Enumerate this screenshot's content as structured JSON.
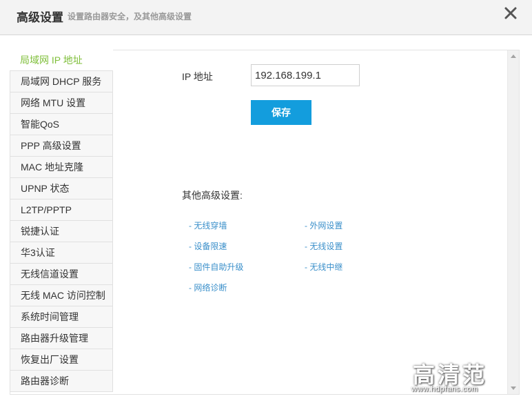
{
  "header": {
    "title": "高级设置",
    "subtitle": "设置路由器安全，及其他高级设置",
    "close_icon": "close-icon"
  },
  "sidebar": {
    "active_color": "#7fbf3a",
    "items": [
      {
        "label": "局域网 IP 地址",
        "active": true
      },
      {
        "label": "局域网 DHCP 服务"
      },
      {
        "label": "网络 MTU 设置"
      },
      {
        "label": "智能QoS"
      },
      {
        "label": "PPP 高级设置"
      },
      {
        "label": "MAC 地址克隆"
      },
      {
        "label": "UPNP 状态"
      },
      {
        "label": "L2TP/PPTP"
      },
      {
        "label": "锐捷认证"
      },
      {
        "label": "华3认证"
      },
      {
        "label": "无线信道设置"
      },
      {
        "label": "无线 MAC 访问控制"
      },
      {
        "label": "系统时间管理"
      },
      {
        "label": "路由器升级管理"
      },
      {
        "label": "恢复出厂设置"
      },
      {
        "label": "路由器诊断"
      }
    ]
  },
  "main": {
    "ip_label": "IP 地址",
    "ip_value": "192.168.199.1",
    "save_label": "保存",
    "save_color": "#139ddd",
    "other_title": "其他高级设置:",
    "links": [
      "- 无线穿墙",
      "- 外网设置",
      "- 设备限速",
      "- 无线设置",
      "- 固件自助升级",
      "- 无线中继",
      "- 网络诊断"
    ]
  },
  "watermark": {
    "main": "高清范",
    "url": "www.hdpfans.com"
  }
}
